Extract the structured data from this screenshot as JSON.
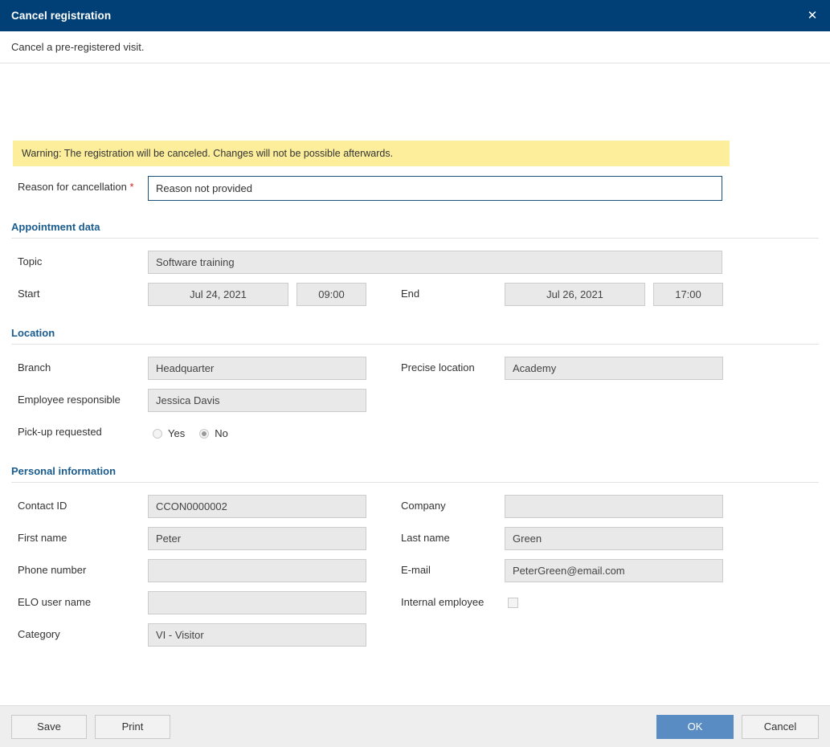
{
  "window": {
    "title": "Cancel registration",
    "close_icon": "close-icon",
    "subtitle": "Cancel a pre-registered visit."
  },
  "warning": {
    "text": "Warning: The registration will be canceled. Changes will not be possible afterwards.",
    "background_color": "#fdee9c"
  },
  "reason": {
    "label": "Reason for cancellation",
    "required_marker": "*",
    "value": "Reason not provided"
  },
  "sections": {
    "appointment": {
      "title": "Appointment data",
      "topic_label": "Topic",
      "topic_value": "Software training",
      "start_label": "Start",
      "start_date": "Jul 24, 2021",
      "start_time": "09:00",
      "end_label": "End",
      "end_date": "Jul 26, 2021",
      "end_time": "17:00"
    },
    "location": {
      "title": "Location",
      "branch_label": "Branch",
      "branch_value": "Headquarter",
      "precise_location_label": "Precise location",
      "precise_location_value": "Academy",
      "employee_label": "Employee responsible",
      "employee_value": "Jessica Davis",
      "pickup_label": "Pick-up requested",
      "pickup_yes": "Yes",
      "pickup_no": "No",
      "pickup_selected": "No"
    },
    "personal": {
      "title": "Personal information",
      "contact_id_label": "Contact ID",
      "contact_id_value": "CCON0000002",
      "company_label": "Company",
      "company_value": "",
      "first_name_label": "First name",
      "first_name_value": "Peter",
      "last_name_label": "Last name",
      "last_name_value": "Green",
      "phone_label": "Phone number",
      "phone_value": "",
      "email_label": "E-mail",
      "email_value": "PeterGreen@email.com",
      "elo_user_label": "ELO user name",
      "elo_user_value": "",
      "internal_employee_label": "Internal employee",
      "internal_employee_checked": false,
      "category_label": "Category",
      "category_value": "VI - Visitor"
    }
  },
  "footer": {
    "save": "Save",
    "print": "Print",
    "ok": "OK",
    "cancel": "Cancel",
    "primary_color": "#5a8cc4"
  }
}
